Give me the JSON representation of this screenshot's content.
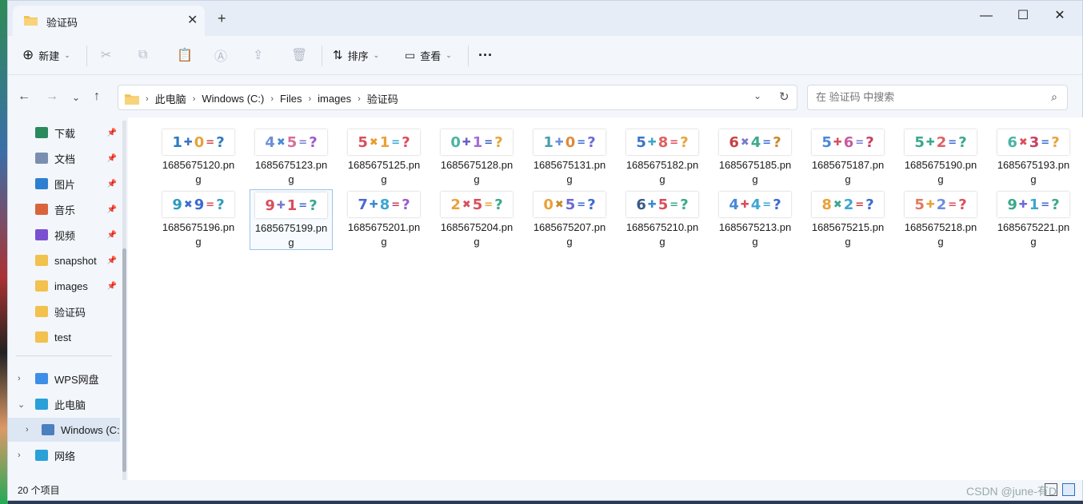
{
  "window": {
    "tab_title": "验证码",
    "minimize": "—",
    "maximize": "☐",
    "close": "✕",
    "new_tab": "+",
    "tab_close": "✕"
  },
  "toolbar": {
    "new_label": "新建",
    "sort_label": "排序",
    "view_label": "查看",
    "more_label": "···"
  },
  "address": {
    "crumbs": [
      "此电脑",
      "Windows (C:)",
      "Files",
      "images",
      "验证码"
    ]
  },
  "search": {
    "placeholder": "在 验证码 中搜索"
  },
  "sidebar": {
    "quick": [
      {
        "label": "下载",
        "icon": "download-icon",
        "color": "#2a8a5c"
      },
      {
        "label": "文档",
        "icon": "document-icon",
        "color": "#7a8fb0"
      },
      {
        "label": "图片",
        "icon": "picture-icon",
        "color": "#2f7fd0"
      },
      {
        "label": "音乐",
        "icon": "music-icon",
        "color": "#d9643c"
      },
      {
        "label": "视频",
        "icon": "video-icon",
        "color": "#7b4fd1"
      },
      {
        "label": "snapshot",
        "icon": "folder-icon",
        "color": "#f2c14e"
      },
      {
        "label": "images",
        "icon": "folder-icon",
        "color": "#f2c14e"
      },
      {
        "label": "验证码",
        "icon": "folder-icon",
        "color": "#f2c14e"
      },
      {
        "label": "test",
        "icon": "folder-icon",
        "color": "#f2c14e"
      }
    ],
    "tree": [
      {
        "label": "WPS网盘",
        "icon": "cloud-icon",
        "color": "#3d8ee6",
        "expand": "›"
      },
      {
        "label": "此电脑",
        "icon": "computer-icon",
        "color": "#2aa0d8",
        "expand": "⌄"
      },
      {
        "label": "Windows (C:",
        "icon": "drive-icon",
        "color": "#4a7fc0",
        "expand": "›"
      },
      {
        "label": "网络",
        "icon": "network-icon",
        "color": "#2aa0d8",
        "expand": "›"
      }
    ]
  },
  "files": [
    {
      "name": "1685675120.png",
      "glyphs": [
        "1",
        "✚",
        "0",
        "=",
        "?"
      ],
      "colors": [
        "#2e7bbf",
        "#3a73c9",
        "#e8a23a",
        "#c94b4b",
        "#2e7bbf"
      ]
    },
    {
      "name": "1685675123.png",
      "glyphs": [
        "4",
        "✖",
        "5",
        "=",
        "?"
      ],
      "colors": [
        "#6c8fd8",
        "#4a89d8",
        "#d46f9a",
        "#7a7ad0",
        "#9c5ad0"
      ]
    },
    {
      "name": "1685675125.png",
      "glyphs": [
        "5",
        "✖",
        "1",
        "=",
        "?"
      ],
      "colors": [
        "#d94f5c",
        "#e89b2a",
        "#e8a23a",
        "#3ba6d4",
        "#d94f5c"
      ]
    },
    {
      "name": "1685675128.png",
      "glyphs": [
        "0",
        "✚",
        "1",
        "=",
        "?"
      ],
      "colors": [
        "#4cb3a3",
        "#6b5fc4",
        "#a56fd0",
        "#365bb8",
        "#e8a23a"
      ]
    },
    {
      "name": "1685675131.png",
      "glyphs": [
        "1",
        "✚",
        "0",
        "=",
        "?"
      ],
      "colors": [
        "#4c9dae",
        "#6b8fe0",
        "#e08a3a",
        "#3c6ad0",
        "#6b6bd8"
      ]
    },
    {
      "name": "1685675182.png",
      "glyphs": [
        "5",
        "✚",
        "8",
        "=",
        "?"
      ],
      "colors": [
        "#3c74c9",
        "#3ca6c9",
        "#e06060",
        "#d94f5c",
        "#e8a23a"
      ]
    },
    {
      "name": "1685675185.png",
      "glyphs": [
        "6",
        "✖",
        "4",
        "=",
        "?"
      ],
      "colors": [
        "#c94040",
        "#7a7ad0",
        "#3aa88c",
        "#3c6ad0",
        "#c98a2a"
      ]
    },
    {
      "name": "1685675187.png",
      "glyphs": [
        "5",
        "✚",
        "6",
        "=",
        "?"
      ],
      "colors": [
        "#4a89d8",
        "#d94f5c",
        "#c95aa0",
        "#7a7ad0",
        "#c94060"
      ]
    },
    {
      "name": "1685675190.png",
      "glyphs": [
        "5",
        "✚",
        "2",
        "=",
        "?"
      ],
      "colors": [
        "#3aa88c",
        "#3aa88c",
        "#e06060",
        "#3c6ad0",
        "#3aa88c"
      ]
    },
    {
      "name": "1685675193.png",
      "glyphs": [
        "6",
        "✖",
        "3",
        "=",
        "?"
      ],
      "colors": [
        "#4cb3a3",
        "#d94f5c",
        "#c94060",
        "#3c6ad0",
        "#e8a23a"
      ]
    },
    {
      "name": "1685675196.png",
      "glyphs": [
        "9",
        "✖",
        "9",
        "=",
        "?"
      ],
      "colors": [
        "#2e9bbf",
        "#3c6ad0",
        "#3c6ad0",
        "#d94f5c",
        "#2e9bbf"
      ]
    },
    {
      "name": "1685675199.png",
      "glyphs": [
        "9",
        "✚",
        "1",
        "=",
        "?"
      ],
      "colors": [
        "#d94f5c",
        "#7a7ad0",
        "#d94f5c",
        "#3c6ad0",
        "#3aa88c"
      ]
    },
    {
      "name": "1685675201.png",
      "glyphs": [
        "7",
        "✚",
        "8",
        "=",
        "?"
      ],
      "colors": [
        "#4a6ad0",
        "#3c8ad0",
        "#3ca6d4",
        "#c94060",
        "#9c5ad0"
      ]
    },
    {
      "name": "1685675204.png",
      "glyphs": [
        "2",
        "✖",
        "5",
        "=",
        "?"
      ],
      "colors": [
        "#e8a23a",
        "#d94f5c",
        "#d94f5c",
        "#e8a23a",
        "#3aa88c"
      ]
    },
    {
      "name": "1685675207.png",
      "glyphs": [
        "0",
        "✖",
        "5",
        "=",
        "?"
      ],
      "colors": [
        "#e8a23a",
        "#c98a2a",
        "#6b6bd8",
        "#3c6ad0",
        "#3c6ad0"
      ]
    },
    {
      "name": "1685675210.png",
      "glyphs": [
        "6",
        "✚",
        "5",
        "=",
        "?"
      ],
      "colors": [
        "#3a5a8a",
        "#3c8ad0",
        "#d94f5c",
        "#3aa88c",
        "#3aa88c"
      ]
    },
    {
      "name": "1685675213.png",
      "glyphs": [
        "4",
        "✚",
        "4",
        "=",
        "?"
      ],
      "colors": [
        "#4a89d8",
        "#d94f5c",
        "#3ca6d4",
        "#3ca6d4",
        "#3c6ad0"
      ]
    },
    {
      "name": "1685675215.png",
      "glyphs": [
        "8",
        "✖",
        "2",
        "=",
        "?"
      ],
      "colors": [
        "#e8a23a",
        "#3aa88c",
        "#3ca6d4",
        "#c94040",
        "#3c6ad0"
      ]
    },
    {
      "name": "1685675218.png",
      "glyphs": [
        "5",
        "✚",
        "2",
        "=",
        "?"
      ],
      "colors": [
        "#e07a5f",
        "#e8a23a",
        "#6b8fe0",
        "#d94f5c",
        "#d94f5c"
      ]
    },
    {
      "name": "1685675221.png",
      "glyphs": [
        "9",
        "✚",
        "1",
        "=",
        "?"
      ],
      "colors": [
        "#3aa88c",
        "#6b6bd8",
        "#3ca6d4",
        "#3c6ad0",
        "#3aa88c"
      ]
    }
  ],
  "status": {
    "count": "20 个项目"
  },
  "watermark": "CSDN @june-有D"
}
